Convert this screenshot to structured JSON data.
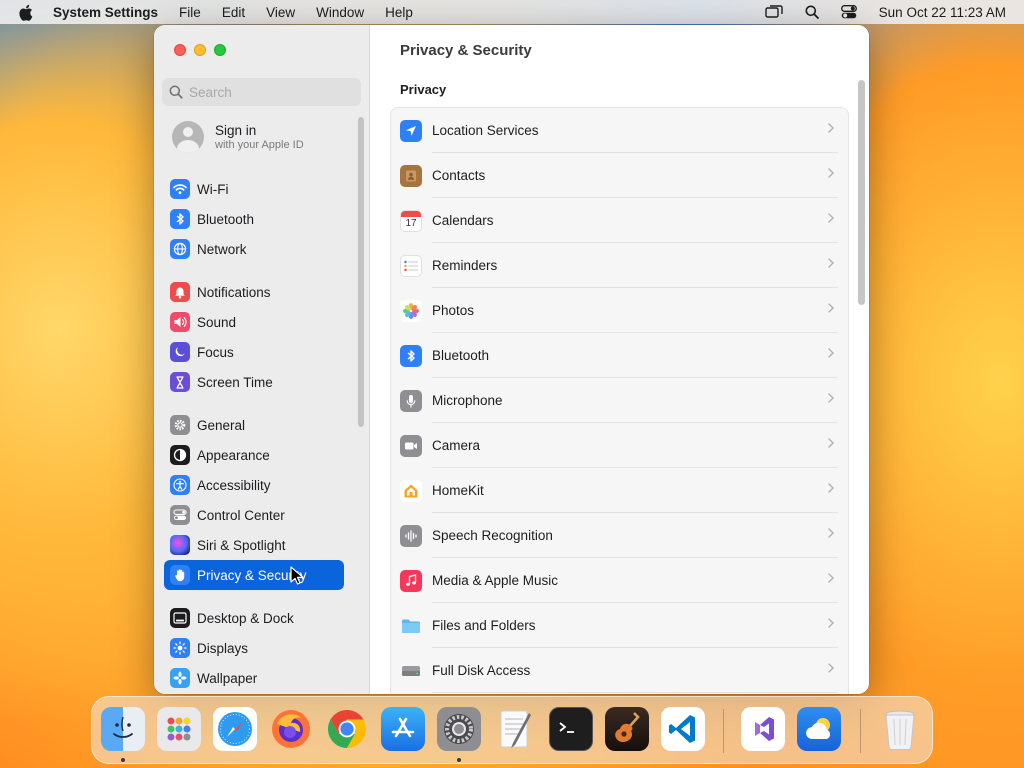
{
  "menubar": {
    "app_name": "System Settings",
    "menus": [
      "File",
      "Edit",
      "View",
      "Window",
      "Help"
    ],
    "clock": "Sun Oct 22  11:23 AM"
  },
  "sidebar": {
    "search_placeholder": "Search",
    "account": {
      "title": "Sign in",
      "subtitle": "with your Apple ID"
    },
    "items": [
      {
        "label": "Wi-Fi",
        "icon": "wifi-icon",
        "color": "#2f80f6"
      },
      {
        "label": "Bluetooth",
        "icon": "bluetooth-icon",
        "color": "#2f80f6"
      },
      {
        "label": "Network",
        "icon": "network-globe-icon",
        "color": "#2f80f6"
      },
      {
        "label": "Notifications",
        "icon": "notifications-bell-icon",
        "color": "#f04b4b"
      },
      {
        "label": "Sound",
        "icon": "sound-speaker-icon",
        "color": "#f04b6a"
      },
      {
        "label": "Focus",
        "icon": "focus-moon-icon",
        "color": "#5a4fd6"
      },
      {
        "label": "Screen Time",
        "icon": "hourglass-icon",
        "color": "#6a4fd6"
      },
      {
        "label": "General",
        "icon": "gear-icon",
        "color": "#8e8e93"
      },
      {
        "label": "Appearance",
        "icon": "appearance-icon",
        "color": "#1c1c1e"
      },
      {
        "label": "Accessibility",
        "icon": "accessibility-icon",
        "color": "#2f80f6"
      },
      {
        "label": "Control Center",
        "icon": "control-center-icon",
        "color": "#8e8e93"
      },
      {
        "label": "Siri & Spotlight",
        "icon": "siri-icon",
        "color": "#2b2b6b"
      },
      {
        "label": "Privacy & Security",
        "icon": "privacy-hand-icon",
        "color": "#2f80f6",
        "selected": true
      },
      {
        "label": "Desktop & Dock",
        "icon": "desktop-dock-icon",
        "color": "#1c1c1e"
      },
      {
        "label": "Displays",
        "icon": "displays-icon",
        "color": "#2f80f6"
      },
      {
        "label": "Wallpaper",
        "icon": "wallpaper-icon",
        "color": "#3aa0f0"
      }
    ]
  },
  "main": {
    "title": "Privacy & Security",
    "section": "Privacy",
    "rows": [
      {
        "label": "Location Services",
        "icon": "location-arrow-icon",
        "color": "#2f80f6"
      },
      {
        "label": "Contacts",
        "icon": "contacts-icon",
        "color": "#a5743f"
      },
      {
        "label": "Calendars",
        "icon": "calendar-icon",
        "color": "#ffffff",
        "day": "17"
      },
      {
        "label": "Reminders",
        "icon": "reminders-icon",
        "color": "#ffffff"
      },
      {
        "label": "Photos",
        "icon": "photos-flower-icon",
        "color": "#ffffff"
      },
      {
        "label": "Bluetooth",
        "icon": "bluetooth-icon",
        "color": "#2f80f6"
      },
      {
        "label": "Microphone",
        "icon": "microphone-icon",
        "color": "#8e8e93"
      },
      {
        "label": "Camera",
        "icon": "camera-icon",
        "color": "#8e8e93"
      },
      {
        "label": "HomeKit",
        "icon": "homekit-house-icon",
        "color": "#ffffff"
      },
      {
        "label": "Speech Recognition",
        "icon": "speech-waveform-icon",
        "color": "#8e8e93"
      },
      {
        "label": "Media & Apple Music",
        "icon": "music-note-icon",
        "color": "#f5385a"
      },
      {
        "label": "Files and Folders",
        "icon": "folder-icon",
        "color": "#5cb8f0"
      },
      {
        "label": "Full Disk Access",
        "icon": "disk-drive-icon",
        "color": "#8e8e93"
      }
    ]
  },
  "dock": {
    "apps": [
      {
        "name": "finder-icon",
        "running": true
      },
      {
        "name": "launchpad-icon",
        "running": false
      },
      {
        "name": "safari-icon",
        "running": false
      },
      {
        "name": "firefox-icon",
        "running": false
      },
      {
        "name": "chrome-icon",
        "running": false
      },
      {
        "name": "app-store-icon",
        "running": false
      },
      {
        "name": "system-settings-icon",
        "running": true
      },
      {
        "name": "textedit-icon",
        "running": false
      },
      {
        "name": "terminal-icon",
        "running": false
      },
      {
        "name": "garageband-icon",
        "running": false
      },
      {
        "name": "vscode-icon",
        "running": false
      },
      {
        "name": "visual-studio-icon",
        "running": false
      },
      {
        "name": "weather-icon",
        "running": false
      },
      {
        "name": "trash-icon",
        "running": false
      }
    ]
  }
}
